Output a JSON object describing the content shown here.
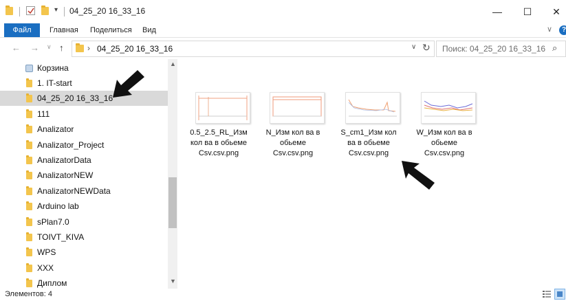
{
  "window": {
    "title": "04_25_20 16_33_16",
    "qat_dropdown": "▾",
    "minimize": "—",
    "maximize": "☐",
    "close": "✕"
  },
  "ribbon": {
    "tabs": [
      "Файл",
      "Главная",
      "Поделиться",
      "Вид"
    ],
    "expand": "∨",
    "help": "?"
  },
  "address": {
    "back": "←",
    "forward": "→",
    "recent": "∨",
    "up": "↑",
    "chevron": "›",
    "path": "04_25_20 16_33_16",
    "dropdown": "∨",
    "refresh": "↻",
    "search_placeholder": "Поиск: 04_25_20 16_33_16",
    "search_icon": "⌕"
  },
  "nav": {
    "items": [
      {
        "label": "Корзина",
        "icon": "recycle-bin-icon"
      },
      {
        "label": "1. IT-start",
        "icon": "folder-icon"
      },
      {
        "label": "04_25_20 16_33_16",
        "icon": "folder-icon",
        "selected": true
      },
      {
        "label": "111",
        "icon": "folder-icon"
      },
      {
        "label": "Analizator",
        "icon": "folder-icon"
      },
      {
        "label": "Analizator_Project",
        "icon": "folder-icon"
      },
      {
        "label": "AnalizatorData",
        "icon": "folder-icon"
      },
      {
        "label": "AnalizatorNEW",
        "icon": "folder-icon"
      },
      {
        "label": "AnalizatorNEWData",
        "icon": "folder-icon"
      },
      {
        "label": "Arduino lab",
        "icon": "folder-icon"
      },
      {
        "label": "sPlan7.0",
        "icon": "folder-icon"
      },
      {
        "label": "TOIVT_KIVA",
        "icon": "folder-icon"
      },
      {
        "label": "WPS",
        "icon": "folder-icon"
      },
      {
        "label": "XXX",
        "icon": "folder-icon"
      },
      {
        "label": "Диплом",
        "icon": "folder-icon"
      }
    ]
  },
  "scroll": {
    "up": "▲",
    "down": "▼"
  },
  "files": [
    {
      "name": "0.5_2.5_RL_Изм кол ва  в обьеме Csv.csv.png"
    },
    {
      "name": "N_Изм кол ва  в обьеме Csv.csv.png"
    },
    {
      "name": "S_cm1_Изм кол ва  в обьеме Csv.csv.png"
    },
    {
      "name": "W_Изм кол ва  в обьеме Csv.csv.png"
    }
  ],
  "status": {
    "items_count": "Элементов: 4"
  },
  "colors": {
    "accent": "#1a6ec1",
    "folder": "#f3c54d",
    "selection": "#d9d9d9"
  }
}
